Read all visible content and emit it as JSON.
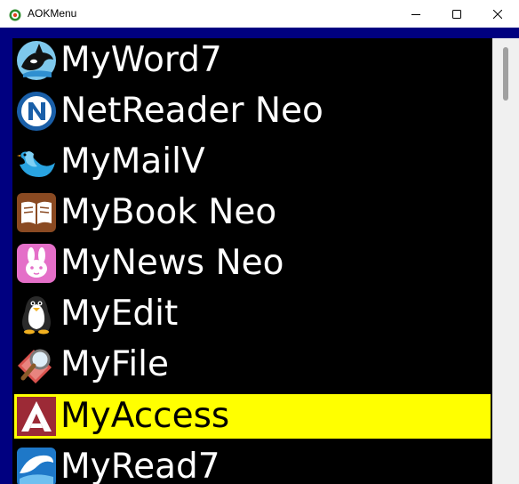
{
  "window": {
    "title": "AOKMenu",
    "app_icon": "aok-app-icon",
    "controls": [
      "minimize-icon",
      "maximize-icon",
      "close-icon"
    ]
  },
  "menu": {
    "selected_index": 7,
    "items": [
      {
        "label": "MyWord7",
        "icon": "orca-icon"
      },
      {
        "label": "NetReader Neo",
        "icon": "n-logo-icon"
      },
      {
        "label": "MyMailⅤ",
        "icon": "bird-icon"
      },
      {
        "label": "MyBook Neo",
        "icon": "open-book-icon"
      },
      {
        "label": "MyNews Neo",
        "icon": "rabbit-icon"
      },
      {
        "label": "MyEdit",
        "icon": "penguin-icon"
      },
      {
        "label": "MyFile",
        "icon": "magnifier-icon"
      },
      {
        "label": "MyAccess",
        "icon": "a-logo-icon"
      },
      {
        "label": "MyRead7",
        "icon": "wave-icon"
      }
    ]
  },
  "colors": {
    "client_background": "#000080",
    "list_background": "#000000",
    "item_text": "#ffffff",
    "selected_background": "#ffff00",
    "selected_text": "#000000"
  }
}
